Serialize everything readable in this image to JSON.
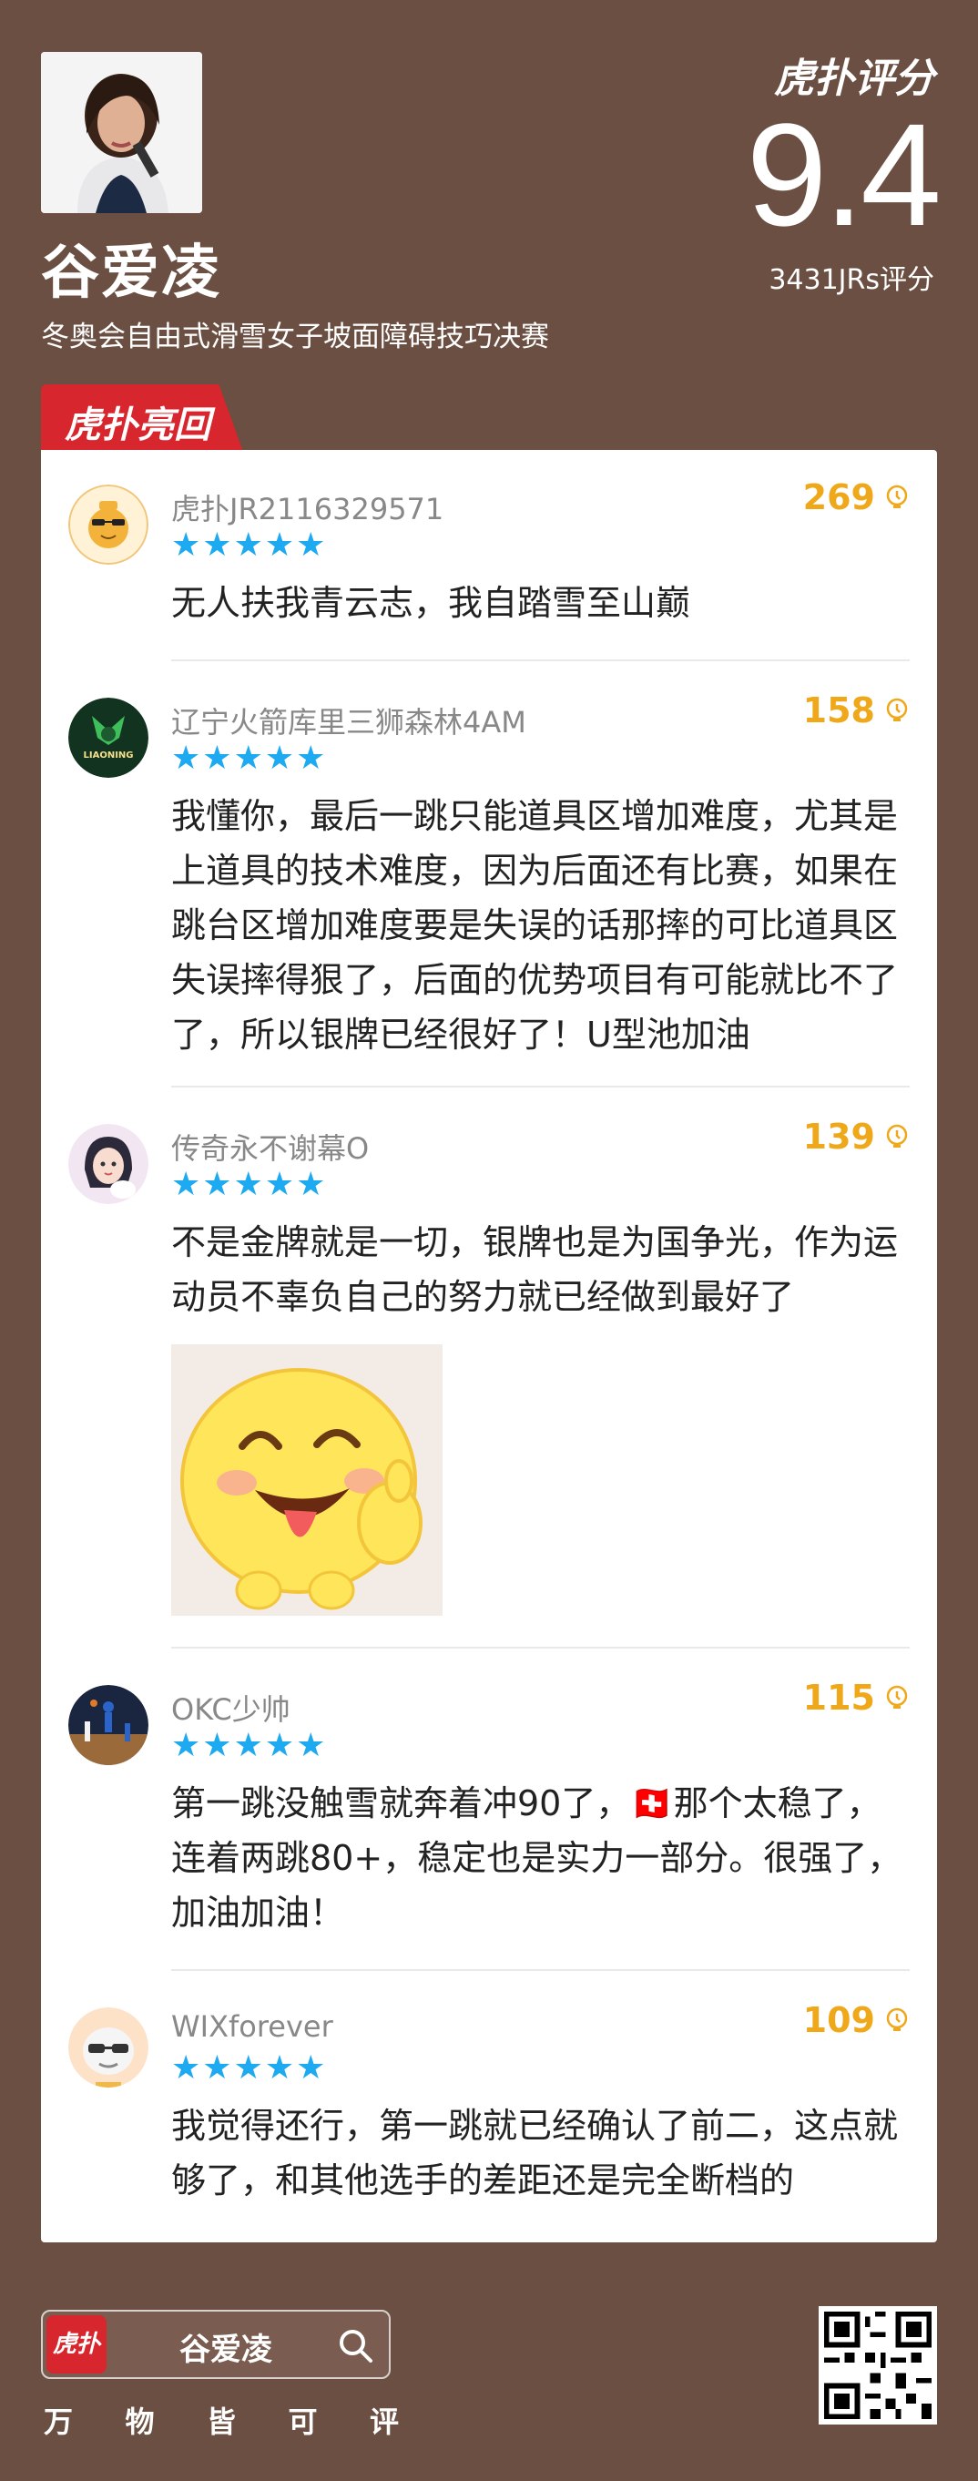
{
  "header": {
    "player_name": "谷爱凌",
    "event_name": "冬奥会自由式滑雪女子坡面障碍技巧决赛",
    "brand_logo": "虎扑评分",
    "score": "9.4",
    "rating_count": "3431JRs评分"
  },
  "section_tag": "虎扑亮回复",
  "comments": [
    {
      "username": "虎扑JR2116329571",
      "stars": 5,
      "likes": "269",
      "text": "无人扶我青云志，我自踏雪至山巅",
      "avatar_icon": "hupu-default-avatar-icon"
    },
    {
      "username": "辽宁火箭库里三狮森林4AM",
      "stars": 5,
      "likes": "158",
      "text": "我懂你，最后一跳只能道具区增加难度，尤其是上道具的技术难度，因为后面还有比赛，如果在跳台区增加难度要是失误的话那摔的可比道具区失误摔得狠了，后面的优势项目有可能就比不了了，所以银牌已经很好了！U型池加油",
      "avatar_icon": "liaoning-team-logo-icon",
      "avatar_text": "LIAONING"
    },
    {
      "username": "传奇永不谢幕O",
      "stars": 5,
      "likes": "139",
      "text": "不是金牌就是一切，银牌也是为国争光，作为运动员不辜负自己的努力就已经做到最好了",
      "avatar_icon": "anime-girl-avatar-icon"
    },
    {
      "username": "OKC少帅",
      "stars": 5,
      "likes": "115",
      "text": "第一跳没触雪就奔着冲90了，🇨🇭那个太稳了，连着两跳80+，稳定也是实力一部分。很强了，加油加油！",
      "avatar_icon": "basketball-photo-avatar-icon"
    },
    {
      "username": "WIXforever",
      "stars": 5,
      "likes": "109",
      "text": "我觉得还行，第一跳就已经确认了前二，这点就够了，和其他选手的差距还是完全断档的",
      "avatar_icon": "sunglasses-avatar-icon"
    }
  ],
  "footer": {
    "search_logo": "虎扑",
    "search_query": "谷爱凌",
    "slogan": [
      "万",
      "物",
      "皆",
      "可",
      "评"
    ]
  },
  "colors": {
    "background": "#6b4f42",
    "accent_red": "#d7262d",
    "likes_orange": "#f0a81b",
    "star_blue": "#1eaaf1"
  }
}
